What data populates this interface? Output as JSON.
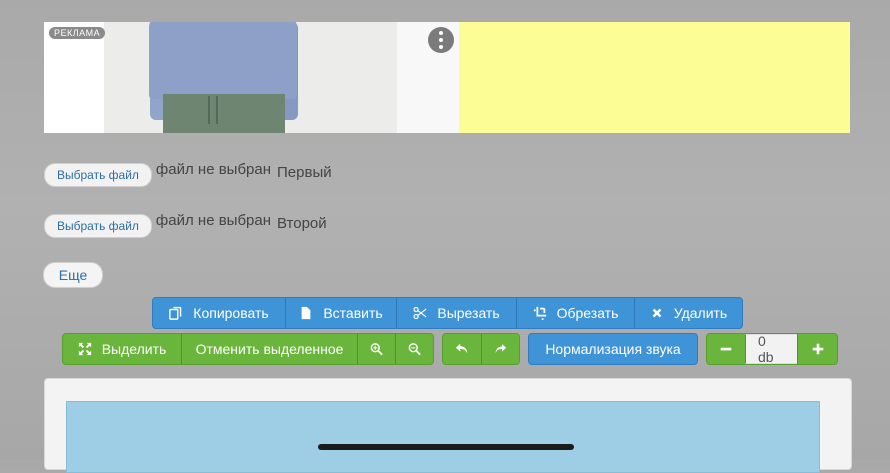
{
  "ad": {
    "badge": "РЕКЛАМА",
    "menu_icon": "more-vertical-icon"
  },
  "files": [
    {
      "button": "Выбрать файл",
      "status": "файл не выбран",
      "name": "Первый"
    },
    {
      "button": "Выбрать файл",
      "status": "файл не выбран",
      "name": "Второй"
    }
  ],
  "more_button": "Еще",
  "edit_toolbar": {
    "copy": "Копировать",
    "paste": "Вставить",
    "cut": "Вырезать",
    "crop": "Обрезать",
    "delete": "Удалить"
  },
  "select_toolbar": {
    "select": "Выделить",
    "deselect": "Отменить выделенное"
  },
  "normalize": "Нормализация звука",
  "volume": {
    "value": "0 db"
  },
  "colors": {
    "blue": "#3f94d8",
    "green": "#6ab63d",
    "ad_yellow": "#fdfd96",
    "canvas": "#9ecde6"
  }
}
